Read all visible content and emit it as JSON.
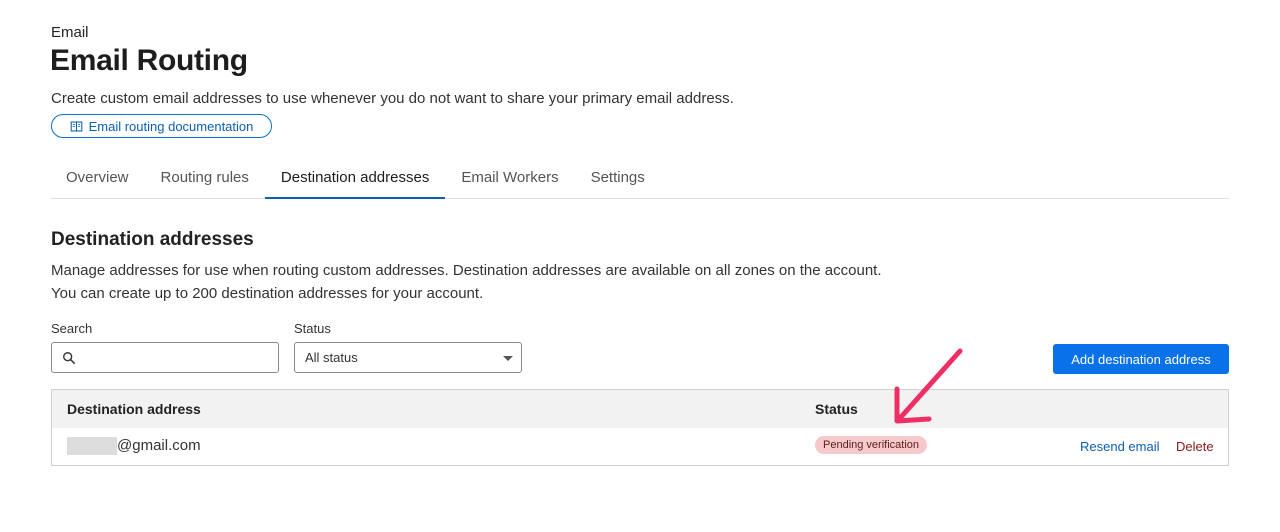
{
  "header": {
    "breadcrumb": "Email",
    "title": "Email Routing",
    "description": "Create custom email addresses to use whenever you do not want to share your primary email address.",
    "doc_link_label": "Email routing documentation"
  },
  "tabs": [
    {
      "label": "Overview"
    },
    {
      "label": "Routing rules"
    },
    {
      "label": "Destination addresses",
      "active": true
    },
    {
      "label": "Email Workers"
    },
    {
      "label": "Settings"
    }
  ],
  "section": {
    "title": "Destination addresses",
    "description_line1": "Manage addresses for use when routing custom addresses. Destination addresses are available on all zones on the account.",
    "description_line2": "You can create up to 200 destination addresses for your account."
  },
  "filters": {
    "search_label": "Search",
    "search_value": "",
    "search_placeholder": "",
    "status_label": "Status",
    "status_value": "All status"
  },
  "actions": {
    "add_label": "Add destination address"
  },
  "table": {
    "columns": [
      "Destination address",
      "Status"
    ],
    "rows": [
      {
        "address": "@gmail.com",
        "status": "Pending verification",
        "resend_label": "Resend email",
        "delete_label": "Delete"
      }
    ]
  },
  "colors": {
    "accent": "#0a72e8",
    "link": "#0b5fb4",
    "badge_bg": "#f6caca",
    "delete": "#8b1a1a",
    "annotation": "#ee2f63"
  }
}
